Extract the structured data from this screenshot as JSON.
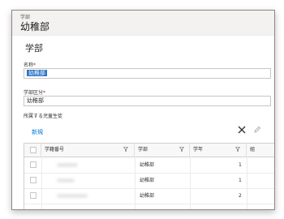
{
  "header": {
    "entity_label": "学部",
    "record_title": "幼稚部"
  },
  "section": {
    "title": "学部"
  },
  "form": {
    "name_label": "名称",
    "name_value": "幼稚部",
    "division_label": "学部区分",
    "division_value": "幼稚部",
    "related_label": "所属する児童生徒"
  },
  "subgrid": {
    "new_label": "新規",
    "columns": [
      "学籍番号",
      "学部",
      "学年",
      "組"
    ],
    "rows": [
      {
        "dept": "幼稚部",
        "grade": "1"
      },
      {
        "dept": "幼稚部",
        "grade": "1"
      },
      {
        "dept": "幼稚部",
        "grade": "2"
      }
    ]
  }
}
